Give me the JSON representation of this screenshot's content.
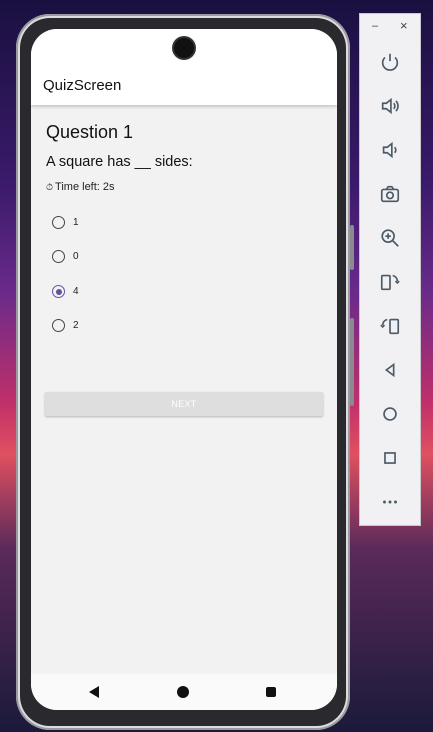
{
  "app": {
    "title": "QuizScreen"
  },
  "quiz": {
    "heading": "Question 1",
    "question": "A square has __ sides:",
    "timer_icon": "⏱",
    "timer_text": "Time left: 2s",
    "options": [
      {
        "label": "1",
        "selected": false
      },
      {
        "label": "0",
        "selected": false
      },
      {
        "label": "4",
        "selected": true
      },
      {
        "label": "2",
        "selected": false
      }
    ],
    "next_label": "NEXT",
    "accent_color": "#6750a4"
  },
  "emulator_toolbar": {
    "minimize": "–",
    "close": "×",
    "buttons": [
      "power-icon",
      "volume-up-icon",
      "volume-down-icon",
      "camera-icon",
      "zoom-in-icon",
      "rotate-left-icon",
      "rotate-right-icon",
      "back-icon",
      "home-icon",
      "overview-icon",
      "more-icon"
    ]
  }
}
